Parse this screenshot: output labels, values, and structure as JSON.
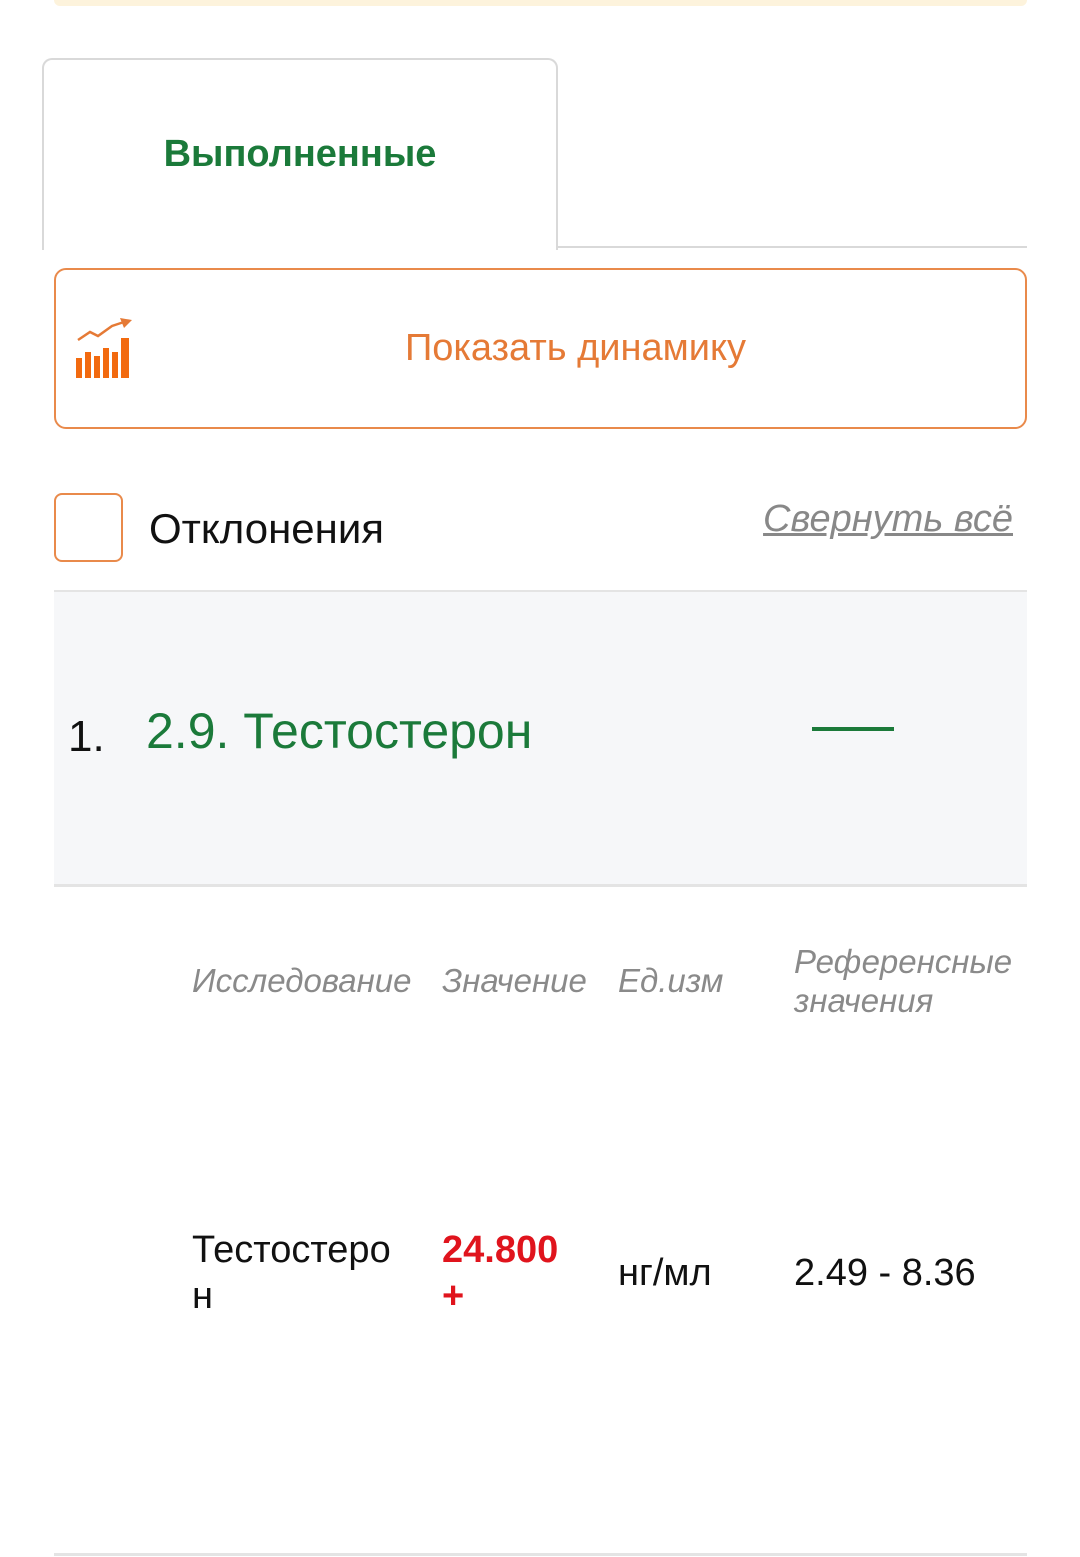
{
  "tabs": {
    "active_label": "Выполненные"
  },
  "dynamics": {
    "button_label": "Показать динамику",
    "icon": "bar-chart-trend-icon"
  },
  "filter": {
    "deviations_label": "Отклонения",
    "deviations_checked": false,
    "collapse_all_label": "Свернуть всё"
  },
  "group": {
    "number": "1.",
    "title": "2.9. Тестостерон",
    "expanded": true,
    "toggle_icon": "minus-icon"
  },
  "results": {
    "columns": [
      "Исследование",
      "Значение",
      "Ед.изм",
      "Референсные значения"
    ],
    "rows": [
      {
        "name": "Тестостерон",
        "value": "24.800 +",
        "unit": "нг/мл",
        "reference": "2.49 - 8.36"
      }
    ]
  },
  "colors": {
    "green": "#1b7a3a",
    "orange": "#e57a36",
    "red": "#e0141d",
    "muted": "#8a8a8a"
  }
}
